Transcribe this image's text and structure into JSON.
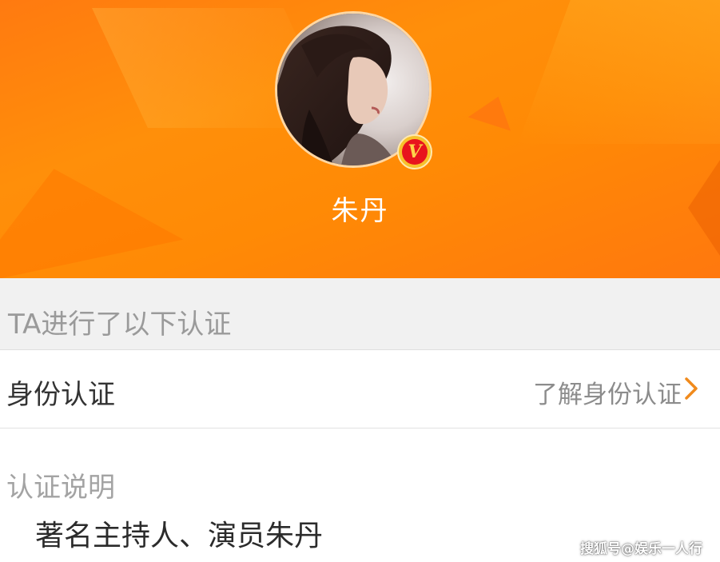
{
  "profile": {
    "name": "朱丹",
    "verified_badge": "V",
    "verified_color": "#e8141d"
  },
  "header": {
    "background_color": "#ff8a05"
  },
  "certification": {
    "section_title": "TA进行了以下认证",
    "identity_label": "身份认证",
    "learn_more_link": "了解身份认证",
    "chevron_icon": "chevron-right-icon",
    "description_label": "认证说明",
    "description_text": "著名主持人、演员朱丹"
  },
  "watermark": {
    "text": "搜狐号@娱乐一人行"
  }
}
